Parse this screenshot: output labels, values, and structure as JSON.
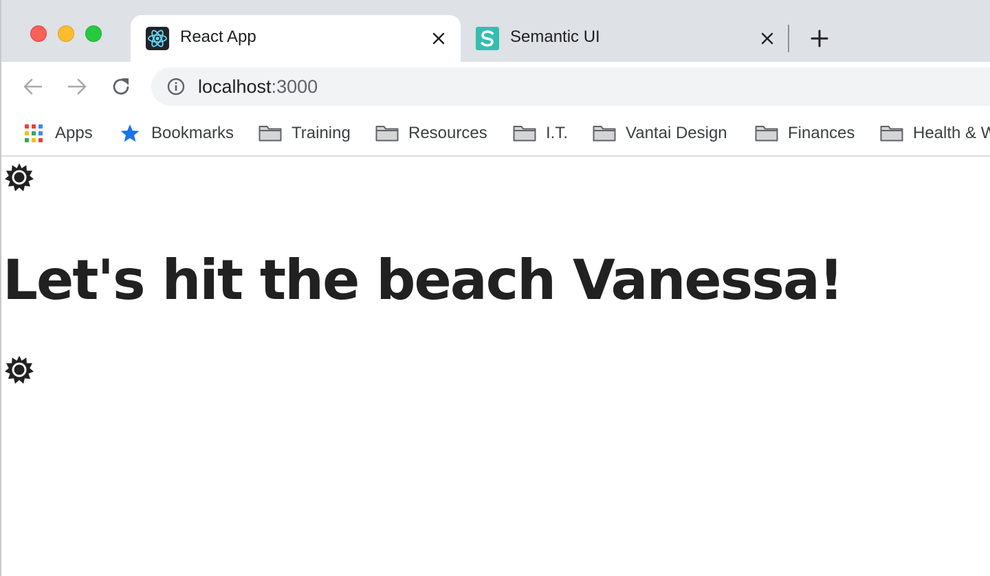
{
  "browser": {
    "tabs": [
      {
        "title": "React App",
        "favicon": "react-icon",
        "active": true
      },
      {
        "title": "Semantic UI",
        "favicon": "semantic-ui-icon",
        "active": false
      }
    ],
    "address": {
      "host": "localhost",
      "port": ":3000"
    },
    "bookmarks": [
      {
        "label": "Apps",
        "icon": "apps-grid-icon"
      },
      {
        "label": "Bookmarks",
        "icon": "star-icon"
      },
      {
        "label": "Training",
        "icon": "folder-icon"
      },
      {
        "label": "Resources",
        "icon": "folder-icon"
      },
      {
        "label": "I.T.",
        "icon": "folder-icon"
      },
      {
        "label": "Vantai Design",
        "icon": "folder-icon"
      },
      {
        "label": "Finances",
        "icon": "folder-icon"
      },
      {
        "label": "Health & W",
        "icon": "folder-icon"
      }
    ]
  },
  "page": {
    "headline": "Let's hit the beach Vanessa!",
    "icons": [
      "sun-icon",
      "sun-icon"
    ]
  },
  "colors": {
    "tabstrip": "#dee1e6",
    "omnibox": "#f1f3f4",
    "text": "#212121",
    "star": "#1a73e8",
    "traffic_red": "#fe5f57",
    "traffic_yellow": "#febc2e",
    "traffic_green": "#28c840"
  }
}
